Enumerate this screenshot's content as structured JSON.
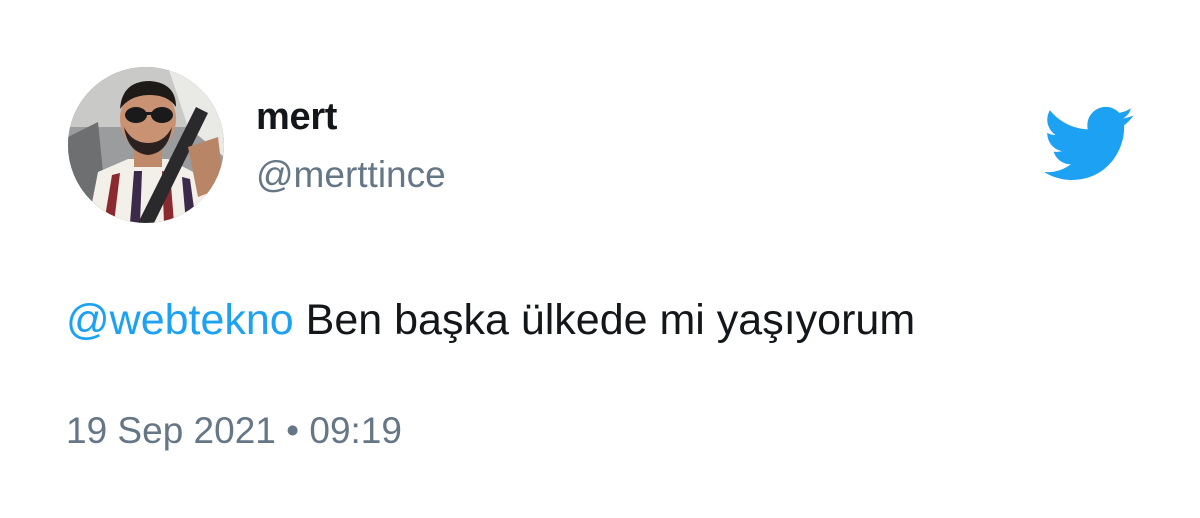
{
  "user": {
    "display_name": "mert",
    "handle": "@merttince",
    "avatar_description_icon": "profile-photo"
  },
  "tweet": {
    "mention": "@webtekno",
    "body": " Ben başka ülkede mi yaşıyorum",
    "date": "19 Sep 2021",
    "separator": " • ",
    "time": "09:19"
  },
  "brand": {
    "icon": "twitter-bird-icon",
    "color": "#1da1f2"
  },
  "colors": {
    "text_primary": "#14171a",
    "text_secondary": "#657786",
    "mention": "#1da1f2"
  }
}
